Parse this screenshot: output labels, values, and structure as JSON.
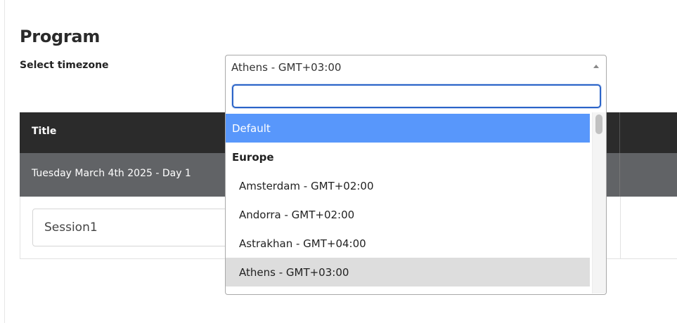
{
  "page": {
    "title": "Program"
  },
  "timezone": {
    "label": "Select timezone",
    "selected_value": "Athens - GMT+03:00",
    "search_placeholder": "",
    "options": [
      {
        "label": "Default",
        "kind": "option",
        "state": "highlighted"
      },
      {
        "label": "Europe",
        "kind": "group"
      },
      {
        "label": "Amsterdam - GMT+02:00",
        "kind": "option"
      },
      {
        "label": "Andorra - GMT+02:00",
        "kind": "option"
      },
      {
        "label": "Astrakhan - GMT+04:00",
        "kind": "option"
      },
      {
        "label": "Athens - GMT+03:00",
        "kind": "option",
        "state": "selected"
      }
    ]
  },
  "schedule": {
    "header_title": "Title",
    "day_label": "Tuesday March 4th 2025 - Day 1",
    "session_value": "Session1"
  },
  "colors": {
    "highlight": "#5897fb",
    "selected": "#dddddd",
    "table_header": "#2b2b2b",
    "day_row": "#616366",
    "focus_border": "#2b64c8"
  },
  "icons": {
    "select_arrow": "caret-up-icon"
  }
}
